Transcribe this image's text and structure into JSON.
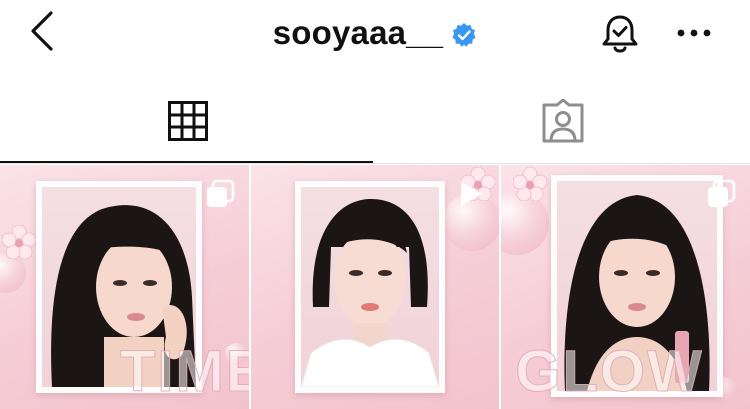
{
  "header": {
    "username": "sooyaaa__",
    "back_icon": "chevron-left-icon",
    "verified_icon": "verified-badge-icon",
    "bell_icon": "bell-check-icon",
    "more_icon": "more-horizontal-icon"
  },
  "tabs": [
    {
      "icon": "grid-icon",
      "active": true
    },
    {
      "icon": "tagged-person-icon",
      "active": false
    }
  ],
  "posts": [
    {
      "word": "TIME",
      "type": "carousel",
      "icon": "multiple-images-icon"
    },
    {
      "word": "",
      "type": "reel",
      "icon": "play-icon"
    },
    {
      "word": "GLOW",
      "type": "carousel",
      "icon": "multiple-images-icon"
    }
  ],
  "colors": {
    "verified": "#3897f0",
    "post_bg": "#f6cdd6"
  }
}
